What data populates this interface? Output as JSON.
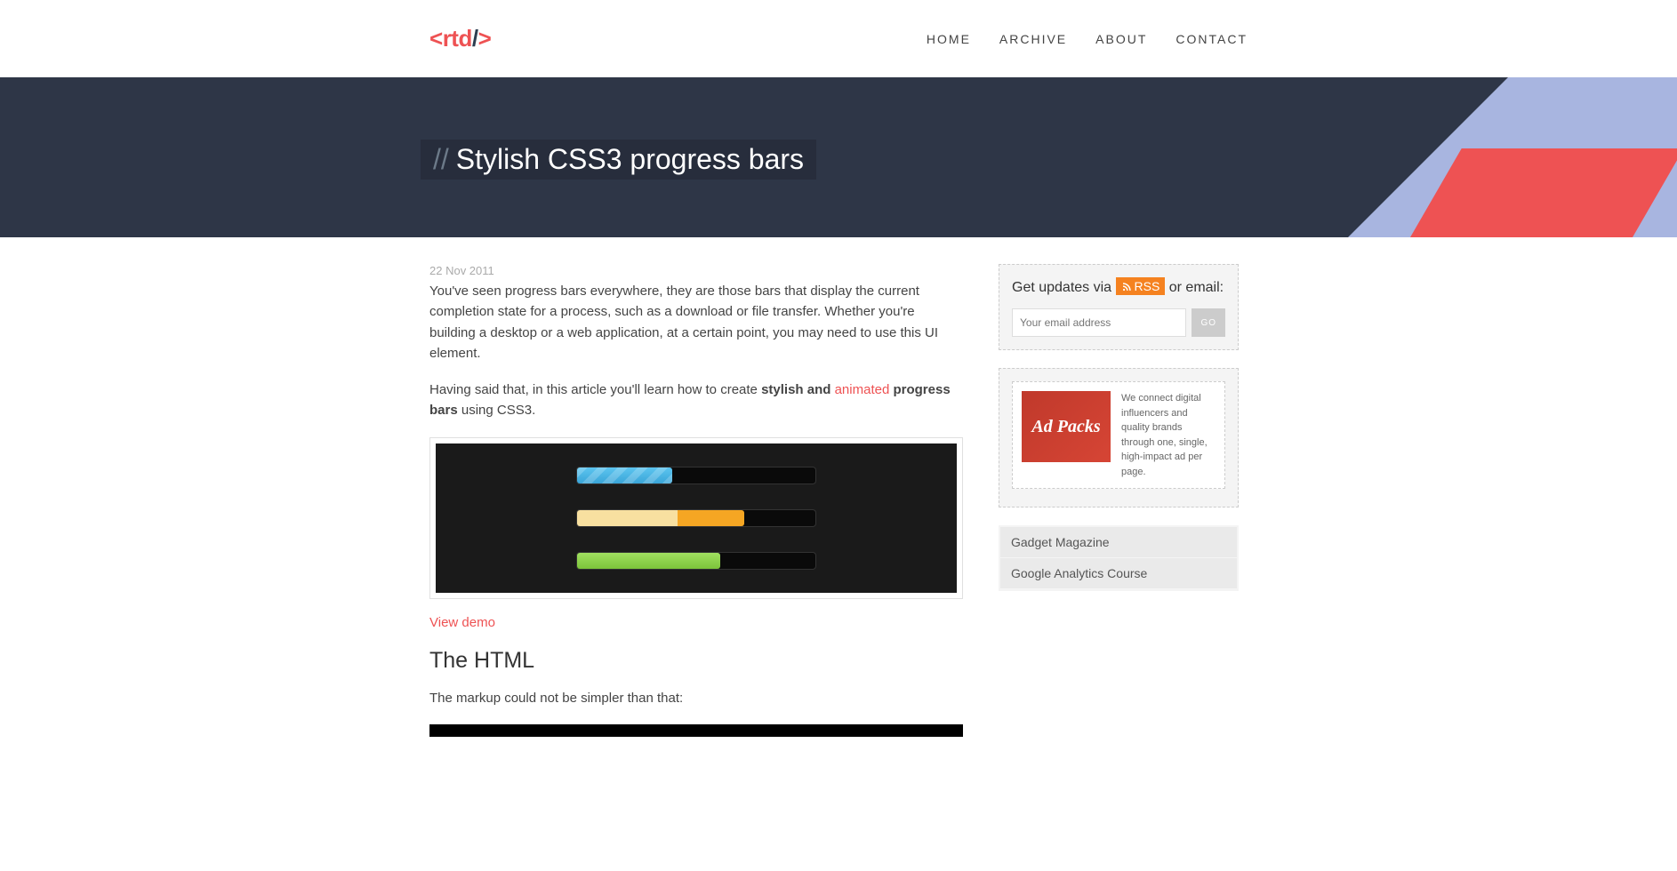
{
  "logo": {
    "open": "<",
    "text": "rtd",
    "slash": "/",
    "close": ">"
  },
  "nav": {
    "home": "HOME",
    "archive": "ARCHIVE",
    "about": "ABOUT",
    "contact": "CONTACT"
  },
  "hero": {
    "slashes": "//",
    "title": "Stylish CSS3 progress bars"
  },
  "article": {
    "date": "22 Nov 2011",
    "p1": "You've seen progress bars everywhere, they are those bars that display the current completion state for a process, such as a download or file transfer. Whether you're building a desktop or a web application, at a certain point, you may need to use this UI element.",
    "p2_a": "Having said that, in this article you'll learn how to create ",
    "p2_b": "stylish and ",
    "p2_c": "animated",
    "p2_d": " progress bars",
    "p2_e": " using CSS3.",
    "view_demo": "View demo",
    "section_html": "The HTML",
    "p3": "The markup could not be simpler than that:"
  },
  "sidebar": {
    "updates_a": "Get updates via ",
    "rss": "RSS",
    "updates_b": " or email:",
    "email_placeholder": "Your email address",
    "go": "GO",
    "ad_logo": "Ad Packs",
    "ad_text": "We connect digital influencers and quality brands through one, single, high-impact ad per page.",
    "link1": "Gadget Magazine",
    "link2": "Google Analytics Course"
  }
}
